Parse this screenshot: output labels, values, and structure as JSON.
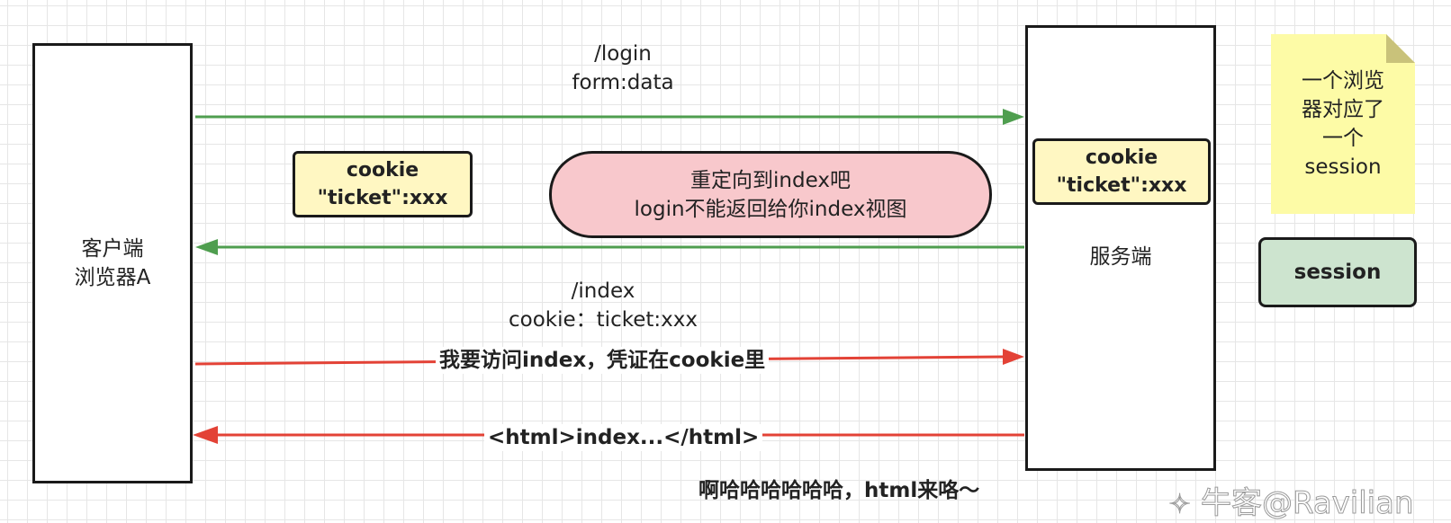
{
  "client": {
    "line1": "客户端",
    "line2": "浏览器A"
  },
  "server": {
    "label": "服务端"
  },
  "login_request": {
    "line1": "/login",
    "line2": "form:data"
  },
  "cookie_tag_client": {
    "line1": "cookie",
    "line2": "\"ticket\":xxx"
  },
  "cookie_tag_server": {
    "line1": "cookie",
    "line2": "\"ticket\":xxx"
  },
  "redirect_note": {
    "line1": "重定向到index吧",
    "line2": "login不能返回给你index视图"
  },
  "index_request": {
    "line1": "/index",
    "line2": "cookie：ticket:xxx"
  },
  "visit_label": "我要访问index，凭证在cookie里",
  "response_label": "<html>index...</html>",
  "laugh_label": "啊哈哈哈哈哈哈，html来咯～",
  "sticky_note": {
    "line1": "一个浏览",
    "line2": "器对应了",
    "line3": "一个",
    "line4": "session"
  },
  "session_label": "session",
  "watermark": "牛客@Ravilian",
  "colors": {
    "green_arrow": "#4f9e4f",
    "red_arrow": "#e34236",
    "pill_fill": "#f8c8cc",
    "tag_fill": "#fff7c2",
    "note_fill": "#fdfba6",
    "session_fill": "#cde4cf"
  }
}
